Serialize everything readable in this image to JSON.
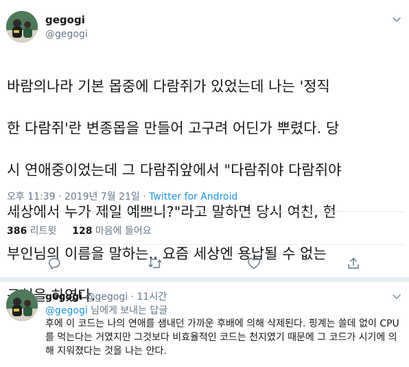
{
  "tweet": {
    "author_name": "gegogi",
    "author_handle": "@gegogi",
    "text": "바람의나라 기본 몹중에 다람쥐가 있었는데 나는 '정직한 다람쥐'란 변종몹을 만들어 고구려 어딘가 뿌렸다. 당시 연애중이었는데 그 다람쥐앞에서 \"다람쥐야 다람쥐야 세상에서 누가 제일 예쁘니?\"라고 말하면 당시 여친, 현 부인님의 이름을 말하는.. 요즘 세상엔 용납될 수 없는 구현을 하였다.",
    "text_lines": [
      "바람의나라 기본 몹중에 다람쥐가 있었는데 나는 '정직",
      "한 다람쥐'란 변종몹을 만들어 고구려 어딘가 뿌렸다. 당",
      "시 연애중이었는데 그 다람쥐앞에서 \"다람쥐야 다람쥐야",
      "세상에서 누가 제일 예쁘니?\"라고 말하면 당시 여친, 현",
      "부인님의 이름을 말하는.. 요즘 세상엔 용납될 수 없는",
      "구현을 하였다."
    ],
    "timestamp": "오후 11:39 · 2019년 7월 21일 · ",
    "source": "Twitter for Android",
    "retweet_count": "386",
    "retweet_label": " 리트윗",
    "like_count": "128",
    "like_label": " 마음에 들어요"
  },
  "actions": {
    "reply_icon": "comment-icon",
    "retweet_icon": "retweet-icon",
    "like_icon": "heart-icon",
    "share_icon": "share-icon"
  },
  "reply": {
    "author_name": "gegogi",
    "author_handle": "@gegogi",
    "separator": " · ",
    "time": "11시간",
    "replying_to_mention": "@gegogi",
    "replying_to_suffix": " 님에게 보내는 답글",
    "text": "후에 이 코드는 나의 연애를 샘내던 가까운 후배에 의해 삭제된다. 핑계는 쓸데 없이 CPU를 먹는다는 거였지만 그것보다 비효율적인 코드는 천지였기 때문에 그 코드가 시기에 의해 지워졌다는 것을 나는 안다."
  },
  "colors": {
    "accent": "#1b95e0",
    "secondary_text": "#657786",
    "divider": "#e6ecf0"
  }
}
